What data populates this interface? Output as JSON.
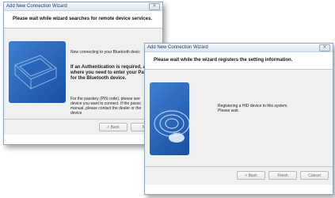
{
  "back_window": {
    "title": "Add New Connection Wizard",
    "header": "Please wait while wizard searches for remote device services.",
    "connecting_text": "Now connecting to your Bluetooth devic",
    "auth_line1": "If an Authentication is required, a",
    "auth_line2": "where you need to enter your Pa",
    "auth_line3": "for the Bluetooth device.",
    "passkey_line1": "For the passkey (PIN code), please see",
    "passkey_line2": "device you want to connect. If the passo",
    "passkey_line3": "manual, please contact the dealer or the",
    "passkey_line4": "device",
    "back_button": "< Back",
    "next_button_partial": "Ne"
  },
  "front_window": {
    "title": "Add New Connection Wizard",
    "header": "Please wait while the wizard registers the setting information.",
    "status_line1": "Registering a HID device to this system.",
    "status_line2": "Please wait.",
    "back_button": "< Back",
    "finish_button": "Finish",
    "cancel_button": "Cancel"
  },
  "close_glyph": "✕"
}
